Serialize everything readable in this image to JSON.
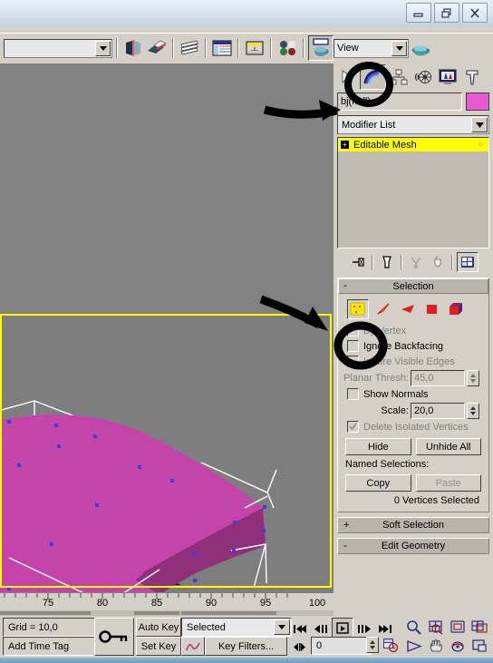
{
  "window": {
    "buttons": [
      {
        "name": "minimize",
        "glyph": "minimize-icon"
      },
      {
        "name": "restore",
        "glyph": "restore-icon"
      },
      {
        "name": "close",
        "glyph": "close-icon"
      }
    ]
  },
  "toolbar": {
    "name_field_value": "",
    "view_selector_value": "View",
    "buttons": [
      {
        "name": "mirror",
        "label": "Mirror"
      },
      {
        "name": "align",
        "label": "Align"
      },
      {
        "name": "layer-manager",
        "label": "Layer Manager"
      },
      {
        "name": "curve-editor",
        "label": "Curve Editor"
      },
      {
        "name": "schematic-view",
        "label": "Schematic View"
      },
      {
        "name": "material-editor",
        "label": "Material Editor"
      },
      {
        "name": "render-scene",
        "label": "Render Scene"
      },
      {
        "name": "quick-render",
        "label": "Quick Render"
      }
    ]
  },
  "viewport": {
    "background_color": "#818181",
    "active_border_color": "#ffff00",
    "object_color": "#c444ab",
    "object_side_color": "#96307f",
    "gizmo_color": "#ffffff",
    "vertex_color": "#3f3fd8"
  },
  "timeline": {
    "ticks": [
      75,
      80,
      85,
      90,
      95,
      100
    ],
    "tick_start": 73,
    "tick_end": 101
  },
  "command_panel": {
    "tabs": [
      {
        "name": "create",
        "icon": "create-arrow-icon",
        "active": false
      },
      {
        "name": "modify",
        "icon": "modify-arc-icon",
        "active": true
      },
      {
        "name": "hierarchy",
        "icon": "hierarchy-icon",
        "active": false
      },
      {
        "name": "motion",
        "icon": "motion-wheel-icon",
        "active": false
      },
      {
        "name": "display",
        "icon": "display-monitor-icon",
        "active": false
      },
      {
        "name": "utilities",
        "icon": "utilities-hammer-icon",
        "active": false
      }
    ],
    "object_name": "bj(null)",
    "object_color": "#e659d0",
    "modifier_list_label": "Modifier List",
    "stack": [
      {
        "label": "Editable Mesh",
        "expand": "+",
        "selected": true
      }
    ],
    "stack_buttons": [
      {
        "name": "pin-stack",
        "icon": "pin-icon"
      },
      {
        "name": "show-end-result",
        "icon": "end-result-icon"
      },
      {
        "name": "make-unique",
        "icon": "make-unique-icon"
      },
      {
        "name": "remove-modifier",
        "icon": "trash-icon"
      },
      {
        "name": "configure-modifier-sets",
        "icon": "configure-icon"
      }
    ]
  },
  "selection_rollout": {
    "title": "Selection",
    "collapse_glyph": "-",
    "sub_object_buttons": [
      {
        "name": "vertex",
        "icon": "vertex-icon",
        "active": true
      },
      {
        "name": "edge",
        "icon": "edge-icon",
        "active": false
      },
      {
        "name": "face",
        "icon": "face-icon",
        "active": false
      },
      {
        "name": "polygon",
        "icon": "polygon-icon",
        "active": false
      },
      {
        "name": "element",
        "icon": "element-icon",
        "active": false
      }
    ],
    "by_vertex_label": "By Vertex",
    "by_vertex_checked": false,
    "by_vertex_disabled": true,
    "ignore_backfacing_label": "Ignore Backfacing",
    "ignore_backfacing_checked": false,
    "ignore_visible_edges_label": "Ignore Visible Edges",
    "ignore_visible_edges_checked": false,
    "ignore_visible_edges_disabled": true,
    "planar_thresh_label": "Planar Thresh:",
    "planar_thresh_value": "45,0",
    "planar_thresh_disabled": true,
    "show_normals_label": "Show Normals",
    "show_normals_checked": false,
    "scale_label": "Scale:",
    "scale_value": "20,0",
    "delete_isolated_label": "Delete Isolated Vertices",
    "delete_isolated_checked": true,
    "delete_isolated_disabled": true,
    "hide_label": "Hide",
    "unhide_all_label": "Unhide All",
    "named_selections_label": "Named Selections:",
    "copy_label": "Copy",
    "paste_label": "Paste",
    "paste_disabled": true,
    "status_text": "0 Vertices Selected"
  },
  "other_rollouts": [
    {
      "name": "soft-selection",
      "label": "Soft Selection",
      "glyph": "+"
    },
    {
      "name": "edit-geometry",
      "label": "Edit Geometry",
      "glyph": "-"
    }
  ],
  "status_bar": {
    "grid_label": "Grid = 10,0",
    "add_time_tag_label": "Add Time Tag",
    "key_mode_icon": "key-icon",
    "auto_key_label": "Auto Key",
    "set_key_label": "Set Key",
    "key_filter_mode": "Selected",
    "key_filters_label": "Key Filters...",
    "curve_icon": "animation-curve-icon",
    "frame_value": "0",
    "playback_buttons": [
      {
        "name": "go-to-start",
        "icon": "go-to-start-icon"
      },
      {
        "name": "previous-frame",
        "icon": "previous-frame-icon"
      },
      {
        "name": "play",
        "icon": "play-icon"
      },
      {
        "name": "next-frame",
        "icon": "next-frame-icon"
      },
      {
        "name": "go-to-end",
        "icon": "go-to-end-icon"
      }
    ],
    "key_nav_icon": "key-nav-icon",
    "time_config_icon": "time-configuration-icon",
    "nav_buttons_top": [
      {
        "name": "zoom",
        "icon": "zoom-magnifier-icon"
      },
      {
        "name": "zoom-all",
        "icon": "zoom-all-icon"
      },
      {
        "name": "zoom-extents",
        "icon": "zoom-extents-icon"
      },
      {
        "name": "zoom-extents-all",
        "icon": "zoom-extents-all-icon"
      }
    ],
    "nav_buttons_bottom": [
      {
        "name": "field-of-view",
        "icon": "field-of-view-icon"
      },
      {
        "name": "pan",
        "icon": "pan-hand-icon"
      },
      {
        "name": "arc-rotate",
        "icon": "arc-rotate-icon"
      },
      {
        "name": "min-max-toggle",
        "icon": "min-max-toggle-icon"
      }
    ]
  },
  "annotations": {
    "color": "#000000",
    "marks": [
      {
        "name": "circle-modify-tab"
      },
      {
        "name": "arrow-to-name-field"
      },
      {
        "name": "arrow-to-viewport"
      },
      {
        "name": "circle-vertex-button"
      }
    ]
  }
}
